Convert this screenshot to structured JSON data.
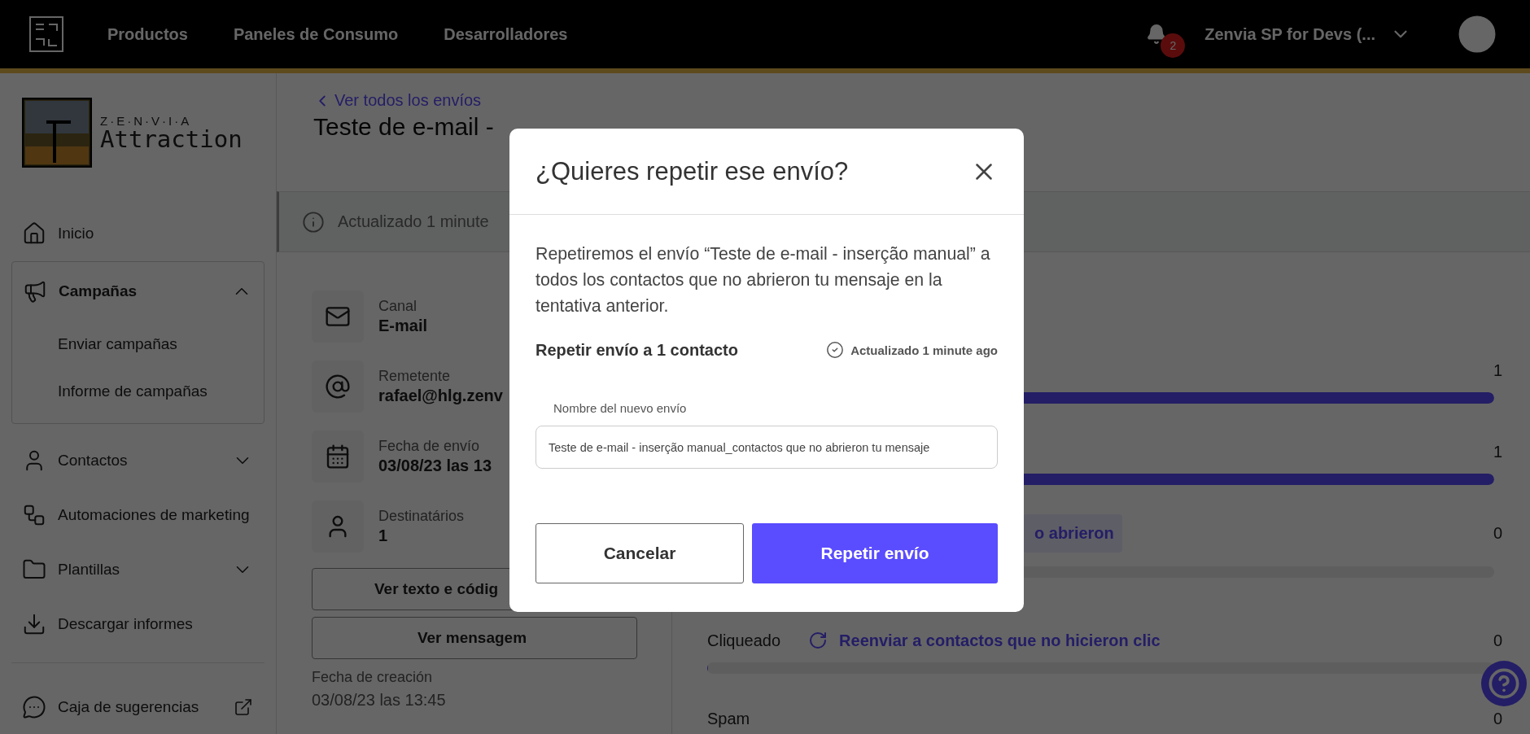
{
  "topbar": {
    "nav": [
      "Productos",
      "Paneles de Consumo",
      "Desarrolladores"
    ],
    "notifications": "2",
    "account": "Zenvia SP for Devs (..."
  },
  "sidebar": {
    "brand_top": "Z·E·N·V·I·A",
    "brand": "Attraction",
    "items": [
      {
        "label": "Inicio"
      },
      {
        "label": "Campañas",
        "expanded": true,
        "children": [
          {
            "label": "Enviar campañas"
          },
          {
            "label": "Informe de campañas"
          }
        ]
      },
      {
        "label": "Contactos",
        "expanded": false
      },
      {
        "label": "Automaciones de marketing"
      },
      {
        "label": "Plantillas",
        "expanded": false
      },
      {
        "label": "Descargar informes"
      }
    ],
    "footer_item": "Caja de sugerencias"
  },
  "header": {
    "back_link": "Ver todos los envíos",
    "title": "Teste de e-mail -",
    "banner": "Actualizado 1 minute"
  },
  "details": [
    {
      "label": "Canal",
      "value": "E-mail"
    },
    {
      "label": "Remetente",
      "value": "rafael@hlg.zenv"
    },
    {
      "label": "Fecha de envío",
      "value": "03/08/23 las 13"
    },
    {
      "label": "Destinatários",
      "value": "1"
    }
  ],
  "detail_buttons": [
    "Ver texto e códig",
    "Ver mensagem"
  ],
  "created": {
    "label": "Fecha de creación",
    "value": "03/08/23 las 13:45"
  },
  "stats": [
    {
      "value": "1",
      "level": 1
    },
    {
      "value": "1",
      "level": 1
    },
    {
      "action": "o abrieron",
      "value": "0",
      "level": 0
    },
    {
      "label": "Cliqueado",
      "action": "Reenviar a contactos que no hicieron clic",
      "value": "0",
      "level": 0
    },
    {
      "label": "Spam",
      "value": "0"
    }
  ],
  "modal": {
    "title": "¿Quieres repetir ese envío?",
    "message": "Repetiremos el envío “Teste de e-mail - inserção manual” a todos los contactos que no abrieron tu mensaje en la tentativa anterior.",
    "subtitle": "Repetir envío a 1 contacto",
    "updated": "Actualizado 1 minute ago",
    "field_label": "Nombre del nuevo envío",
    "field_value": "Teste de e-mail - inserção manual_contactos que no abrieron tu mensaje",
    "cancel": "Cancelar",
    "confirm": "Repetir envío"
  }
}
